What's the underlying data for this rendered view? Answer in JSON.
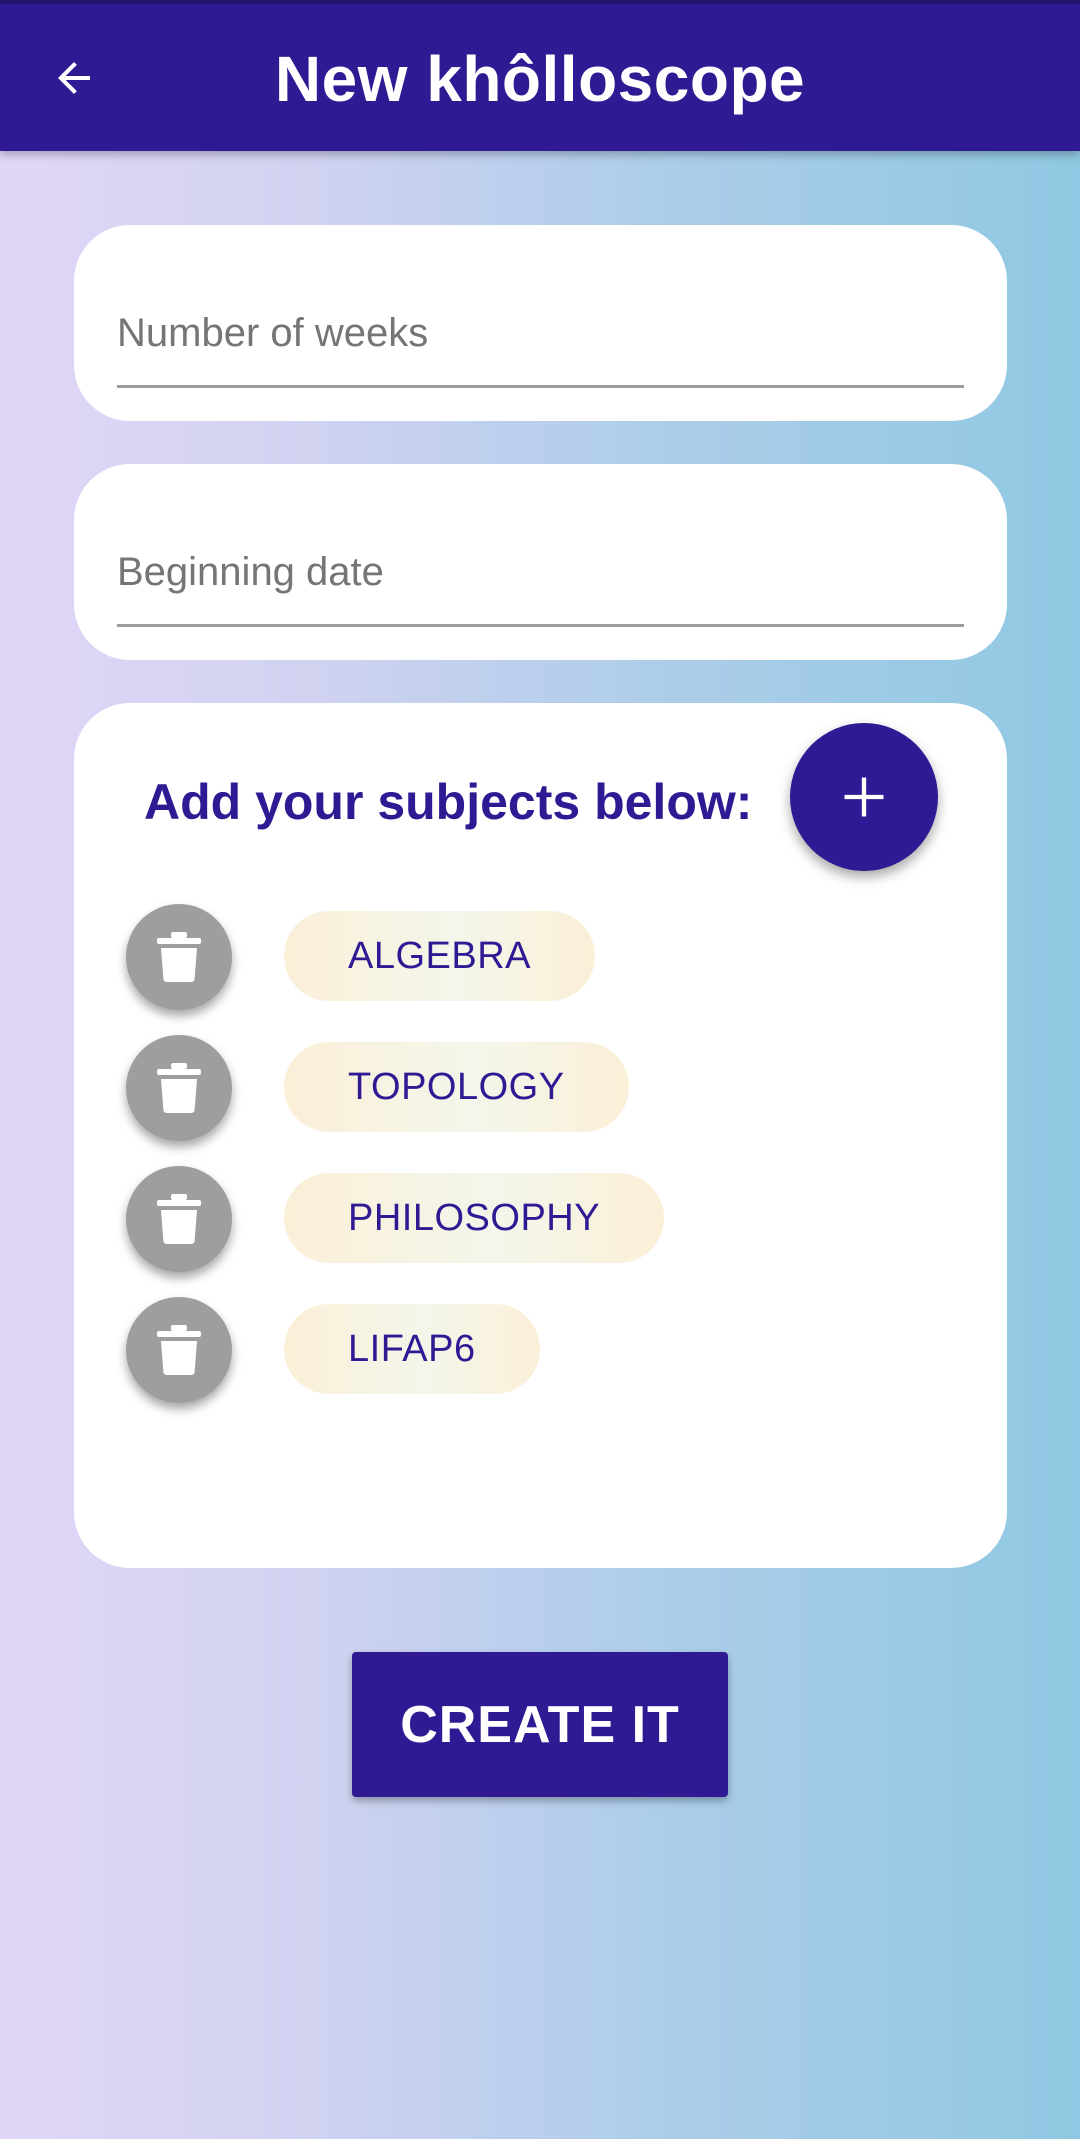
{
  "appbar": {
    "title": "New khôlloscope",
    "back_icon": "arrow-left-icon",
    "color": "#2f1a94"
  },
  "form": {
    "weeks_placeholder": "Number of weeks",
    "weeks_value": "",
    "date_placeholder": "Beginning date",
    "date_value": ""
  },
  "subjects": {
    "title": "Add your subjects below:",
    "add_icon": "plus-icon",
    "delete_icon": "trash-icon",
    "items": [
      {
        "label": "ALGEBRA"
      },
      {
        "label": "TOPOLOGY"
      },
      {
        "label": "PHILOSOPHY"
      },
      {
        "label": "LIFAP6"
      }
    ]
  },
  "create_button": {
    "label": "CREATE IT"
  }
}
